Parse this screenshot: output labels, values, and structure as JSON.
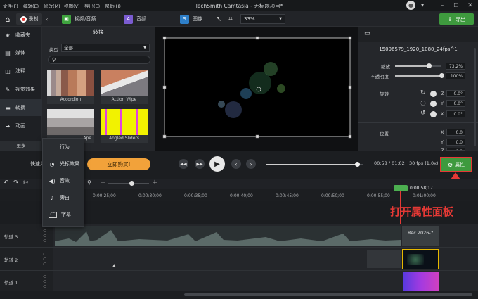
{
  "menu": {
    "items": [
      "文件(F)",
      "编辑(E)",
      "修改(M)",
      "视图(V)",
      "导出(E)",
      "帮助(H)"
    ],
    "title": "TechSmith Camtasia - 无标题项目*"
  },
  "toolbar": {
    "record_label": "录制",
    "tabs": [
      {
        "label": "视频/音频",
        "color": "#3fa43f"
      },
      {
        "label": "音频",
        "color": "#7b5cd1"
      },
      {
        "label": "图像",
        "color": "#2e7fc9"
      }
    ],
    "zoom": "33%",
    "export_label": "导出"
  },
  "sidebar": {
    "items": [
      {
        "label": "收藏夹",
        "icon": "star-icon"
      },
      {
        "label": "媒体",
        "icon": "media-icon"
      },
      {
        "label": "注释",
        "icon": "annotation-icon"
      },
      {
        "label": "视觉效果",
        "icon": "visual-effects-icon"
      },
      {
        "label": "转换",
        "icon": "transition-icon"
      },
      {
        "label": "动画",
        "icon": "animation-icon"
      }
    ],
    "more_label": "更多"
  },
  "panel": {
    "title": "转换",
    "type_label": "类型",
    "type_value": "全部",
    "search_placeholder": "",
    "thumbs": [
      "Accordion",
      "Action Wipe",
      "Ape",
      "Angled Sliders"
    ]
  },
  "dropdown": {
    "items": [
      {
        "label": "行为",
        "icon": "behavior-icon"
      },
      {
        "label": "光标效果",
        "icon": "cursor-effect-icon"
      },
      {
        "label": "音效",
        "icon": "audio-effect-icon"
      },
      {
        "label": "旁白",
        "icon": "microphone-icon"
      },
      {
        "label": "字幕",
        "icon": "captions-icon"
      }
    ]
  },
  "props": {
    "filename": "15096579_1920_1080_24fps^1",
    "scale_label": "缩放",
    "scale_value": "73.2%",
    "scale_fraction": 0.73,
    "opacity_label": "不透明度",
    "opacity_value": "100%",
    "opacity_fraction": 1.0,
    "rotation_label": "旋转",
    "rot_z": "0.0°",
    "rot_y": "0.0°",
    "rot_x": "0.0°",
    "axis_z": "Z",
    "axis_y": "Y",
    "axis_x": "X",
    "position_label": "位置",
    "pos_x": "0.0",
    "pos_y": "0.0",
    "pos_z": "0.0"
  },
  "transport": {
    "quick_label": "快速入",
    "buy_label": "立即购买!",
    "time": "00:58 / 01:02",
    "fps": "30 fps (1.0x)",
    "properties_label": "属性",
    "progress_fraction": 0.94
  },
  "annotation": {
    "text": "打开属性面板",
    "color": "#e53935"
  },
  "timeline": {
    "playhead": "0:00:58;17",
    "ticks": [
      "0:00:25;00",
      "0:00:30;00",
      "0:00:35;00",
      "0:00:40;00",
      "0:00:45;00",
      "0:00:50;00",
      "0:00:55;00",
      "0:01:00;00"
    ],
    "tracks": [
      {
        "label": "轨道 3",
        "clip": "Rec 2026-?"
      },
      {
        "label": "轨道 2",
        "clip": ""
      },
      {
        "label": "轨道 1",
        "clip": ""
      }
    ]
  }
}
